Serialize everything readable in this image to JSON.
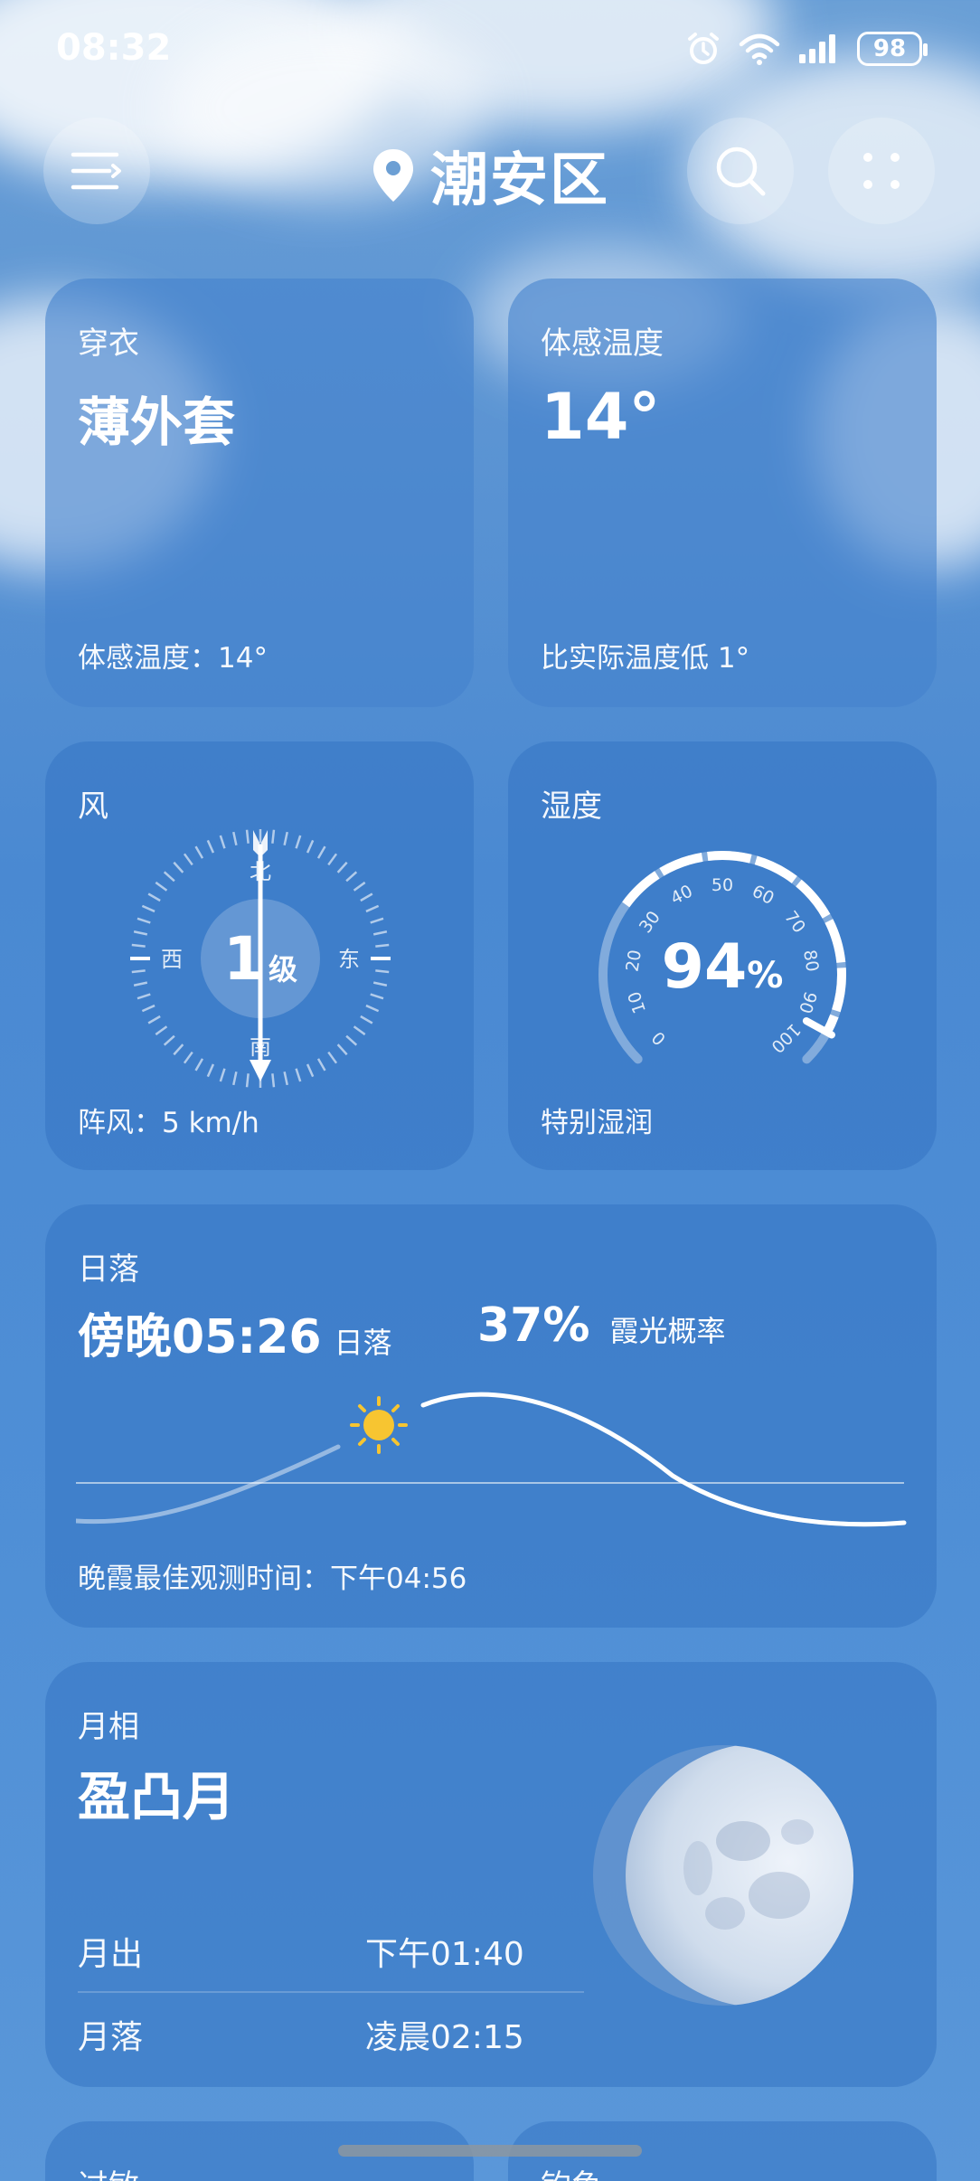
{
  "status_bar": {
    "time": "08:32",
    "battery": "98"
  },
  "header": {
    "location": "潮安区"
  },
  "clothing": {
    "title": "穿衣",
    "value": "薄外套",
    "footer": "体感温度：14°"
  },
  "feels_like": {
    "title": "体感温度",
    "value": "14°",
    "footer": "比实际温度低 1°"
  },
  "wind": {
    "title": "风",
    "level": "1",
    "level_unit": "级",
    "dir_n": "北",
    "dir_s": "南",
    "dir_w": "西",
    "dir_e": "东",
    "footer": "阵风：5 km/h"
  },
  "humidity": {
    "title": "湿度",
    "value": "94",
    "unit": "%",
    "percent": 94,
    "ticks": [
      "0",
      "10",
      "20",
      "30",
      "40",
      "50",
      "60",
      "70",
      "80",
      "90",
      "100"
    ],
    "footer": "特别湿润"
  },
  "sunset": {
    "title": "日落",
    "time": "傍晚05:26",
    "time_label": "日落",
    "probability": "37%",
    "probability_label": "霞光概率",
    "footer": "晚霞最佳观测时间：下午04:56"
  },
  "moon": {
    "title": "月相",
    "phase": "盈凸月",
    "rise_label": "月出",
    "rise_time": "下午01:40",
    "set_label": "月落",
    "set_time": "凌晨02:15"
  },
  "bottom_cards": {
    "left_title": "过敏",
    "right_title": "钓鱼"
  },
  "colors": {
    "sun": "#f7c531",
    "card": "#3a7ac4"
  }
}
